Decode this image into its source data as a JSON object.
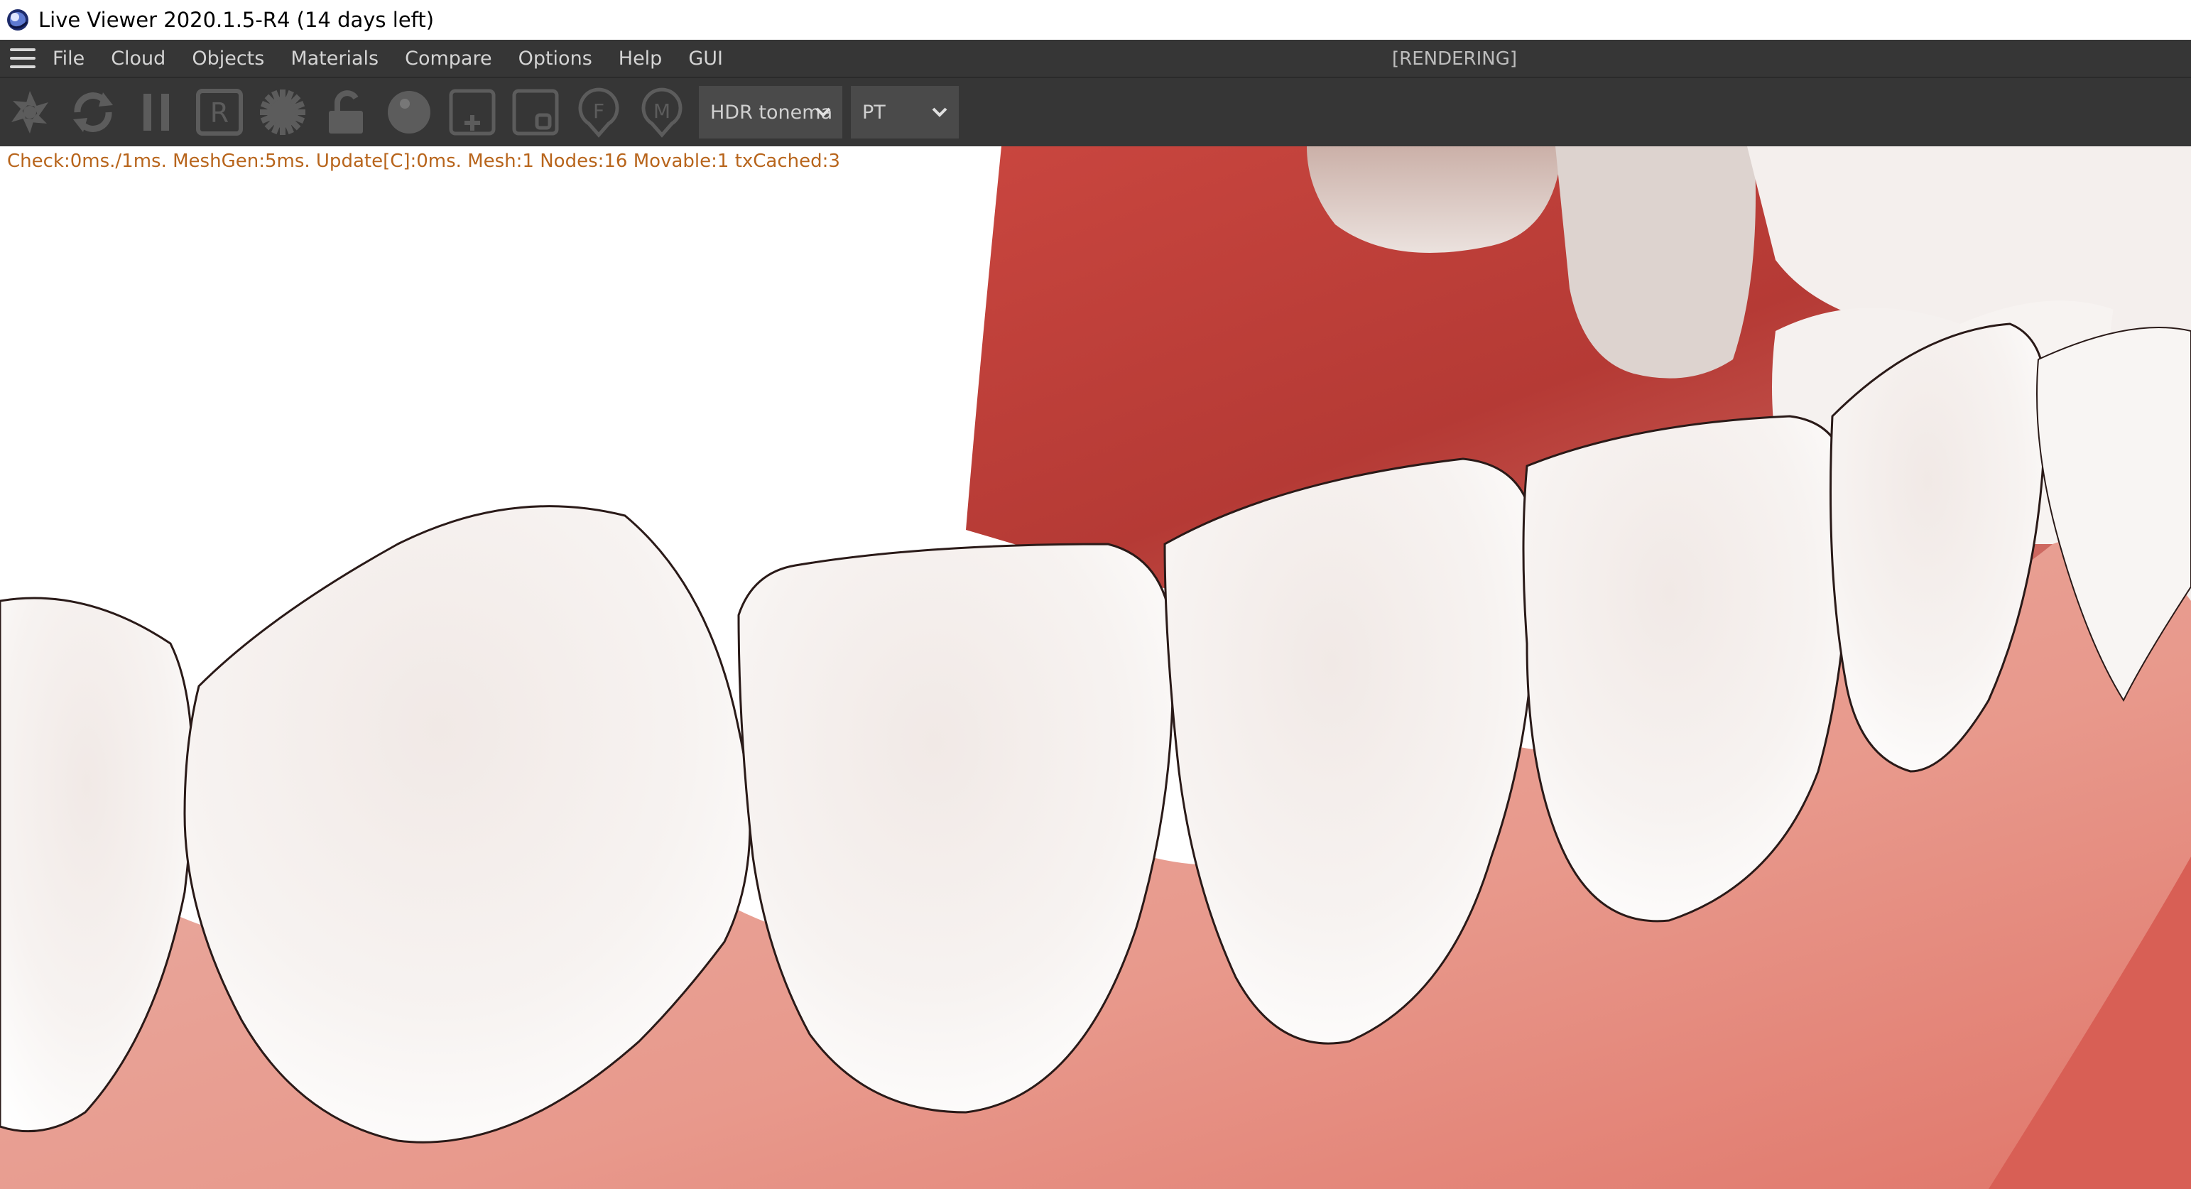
{
  "window": {
    "title": "Live Viewer 2020.1.5-R4 (14 days left)"
  },
  "menubar": {
    "items": [
      "File",
      "Cloud",
      "Objects",
      "Materials",
      "Compare",
      "Options",
      "Help",
      "GUI"
    ],
    "status": "[RENDERING]"
  },
  "toolbar": {
    "icons": [
      "aperture-icon",
      "refresh-icon",
      "pause-icon",
      "r-region-icon",
      "gear-icon",
      "lock-icon",
      "sphere-icon",
      "add-region-icon",
      "region-icon",
      "f-pin-icon",
      "m-pin-icon"
    ],
    "tonemap_value": "HDR tonema",
    "mode_value": "PT"
  },
  "viewport": {
    "stats": "Check:0ms./1ms. MeshGen:5ms. Update[C]:0ms. Mesh:1 Nodes:16 Movable:1 txCached:3"
  },
  "colors": {
    "toolbar_bg": "#363636",
    "icon_gray": "#5c5c5c",
    "stats_text": "#b8651c",
    "gum": "#e79a8e",
    "tooth": "#f7f3f1"
  }
}
